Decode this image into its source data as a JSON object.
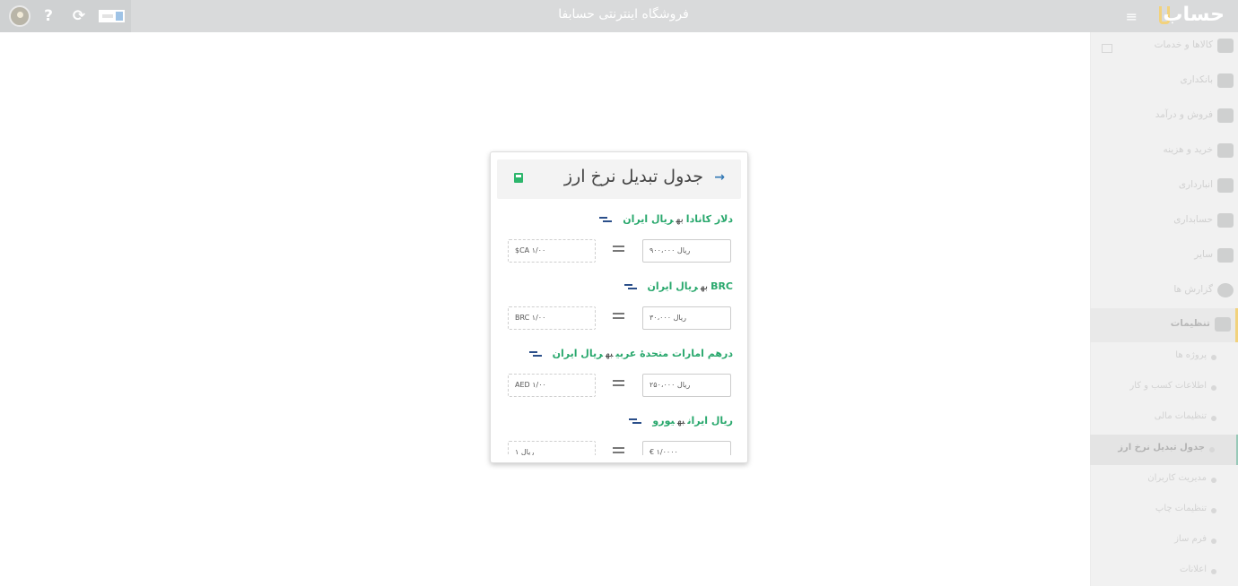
{
  "topbar": {
    "title": "فروشگاه اینترنتی حسابفا",
    "help_glyph": "?",
    "refresh_glyph": "⟳",
    "menu_glyph": "≡",
    "brand_name": "حساب"
  },
  "sidebar": {
    "items": [
      {
        "label": "کالاها و خدمات",
        "icon": "box-icon"
      },
      {
        "label": "بانکداری",
        "icon": "bank-icon"
      },
      {
        "label": "فروش و درآمد",
        "icon": "sales-icon"
      },
      {
        "label": "خرید و هزینه",
        "icon": "purchase-icon"
      },
      {
        "label": "انبارداری",
        "icon": "warehouse-icon"
      },
      {
        "label": "حسابداری",
        "icon": "accounting-icon"
      },
      {
        "label": "سایر",
        "icon": "other-icon"
      },
      {
        "label": "گزارش ها",
        "icon": "reports-icon"
      },
      {
        "label": "تنظیمات",
        "icon": "settings-icon"
      }
    ],
    "settings_sub": [
      {
        "label": "پروژه ها"
      },
      {
        "label": "اطلاعات کسب و کار"
      },
      {
        "label": "تنظیمات مالی"
      },
      {
        "label": "جدول تبدیل نرخ ارز"
      },
      {
        "label": "مدیریت کاربران"
      },
      {
        "label": "تنظیمات چاپ"
      },
      {
        "label": "فرم ساز"
      },
      {
        "label": "اعلانات"
      }
    ]
  },
  "dialog": {
    "title": "جدول تبدیل نرخ ارز",
    "to_word": "به",
    "rates": [
      {
        "from": "دلار کانادا",
        "to": "ریال ایران",
        "rate_value": "ریال ۹۰۰،۰۰۰",
        "base_value": "$CA ۱/۰۰"
      },
      {
        "from": "BRC",
        "to": "ریال ایران",
        "rate_value": "ریال ۳۰،۰۰۰",
        "base_value": "BRC ۱/۰۰"
      },
      {
        "from": "درهم امارات متحدهٔ عربی",
        "to": "ریال ایران",
        "rate_value": "ریال ۲۵۰،۰۰۰",
        "base_value": "AED ۱/۰۰"
      },
      {
        "from": "ریال ایران",
        "to": "یورو",
        "rate_value": "€ ۱/۰۰۰۰",
        "base_value": "ریال ۱"
      }
    ]
  },
  "colors": {
    "accent_green": "#29a86d",
    "link_blue": "#3379b5",
    "brand_yellow": "#f2d27d"
  }
}
